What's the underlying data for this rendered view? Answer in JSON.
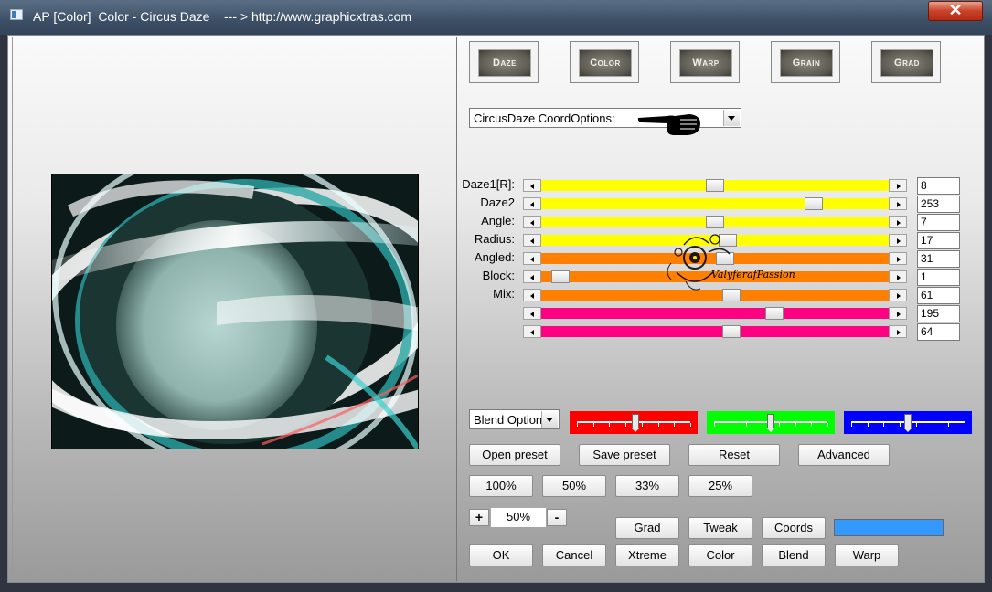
{
  "window": {
    "title": "AP [Color]  Color - Circus Daze    --- > http://www.graphicxtras.com",
    "close_label": "✕"
  },
  "tabs": [
    {
      "label": "Daze"
    },
    {
      "label": "Color"
    },
    {
      "label": "Warp"
    },
    {
      "label": "Grain"
    },
    {
      "label": "Grad"
    }
  ],
  "options_select": {
    "value": "CircusDaze CoordOptions:"
  },
  "params": [
    {
      "label": "Daze1[R]:",
      "value": "8",
      "color": "#ffff00",
      "position": 0.5
    },
    {
      "label": "Daze2",
      "value": "253",
      "color": "#ffff00",
      "position": 0.8
    },
    {
      "label": "Angle:",
      "value": "7",
      "color": "#ffff00",
      "position": 0.5
    },
    {
      "label": "Radius:",
      "value": "17",
      "color": "#ffff00",
      "position": 0.54
    },
    {
      "label": "Angled:",
      "value": "31",
      "color": "#ff8000",
      "position": 0.53
    },
    {
      "label": "Block:",
      "value": "1",
      "color": "#ff8000",
      "position": 0.03
    },
    {
      "label": "Mix:",
      "value": "61",
      "color": "#ff8000",
      "position": 0.55
    },
    {
      "label": "",
      "value": "195",
      "color": "#ff0080",
      "position": 0.68
    },
    {
      "label": "",
      "value": "64",
      "color": "#ff0080",
      "position": 0.55
    }
  ],
  "blend_select": {
    "value": "Blend Option"
  },
  "rgb_sliders": [
    {
      "name": "red",
      "color": "#ff0000",
      "position": 0.52
    },
    {
      "name": "green",
      "color": "#00ff00",
      "position": 0.5
    },
    {
      "name": "blue",
      "color": "#0000ff",
      "position": 0.5
    }
  ],
  "buttons": {
    "open_preset": "Open preset",
    "save_preset": "Save preset",
    "reset": "Reset",
    "advanced": "Advanced",
    "z100": "100%",
    "z50": "50%",
    "z33": "33%",
    "z25": "25%",
    "grad": "Grad",
    "tweak": "Tweak",
    "coords": "Coords",
    "ok": "OK",
    "cancel": "Cancel",
    "xtreme": "Xtreme",
    "color": "Color",
    "blend": "Blend",
    "warp": "Warp"
  },
  "zoom": {
    "plus": "+",
    "minus": "-",
    "value": "50%"
  },
  "swatch_color": "#3399ff",
  "watermark_text": "ValyferafPassion"
}
